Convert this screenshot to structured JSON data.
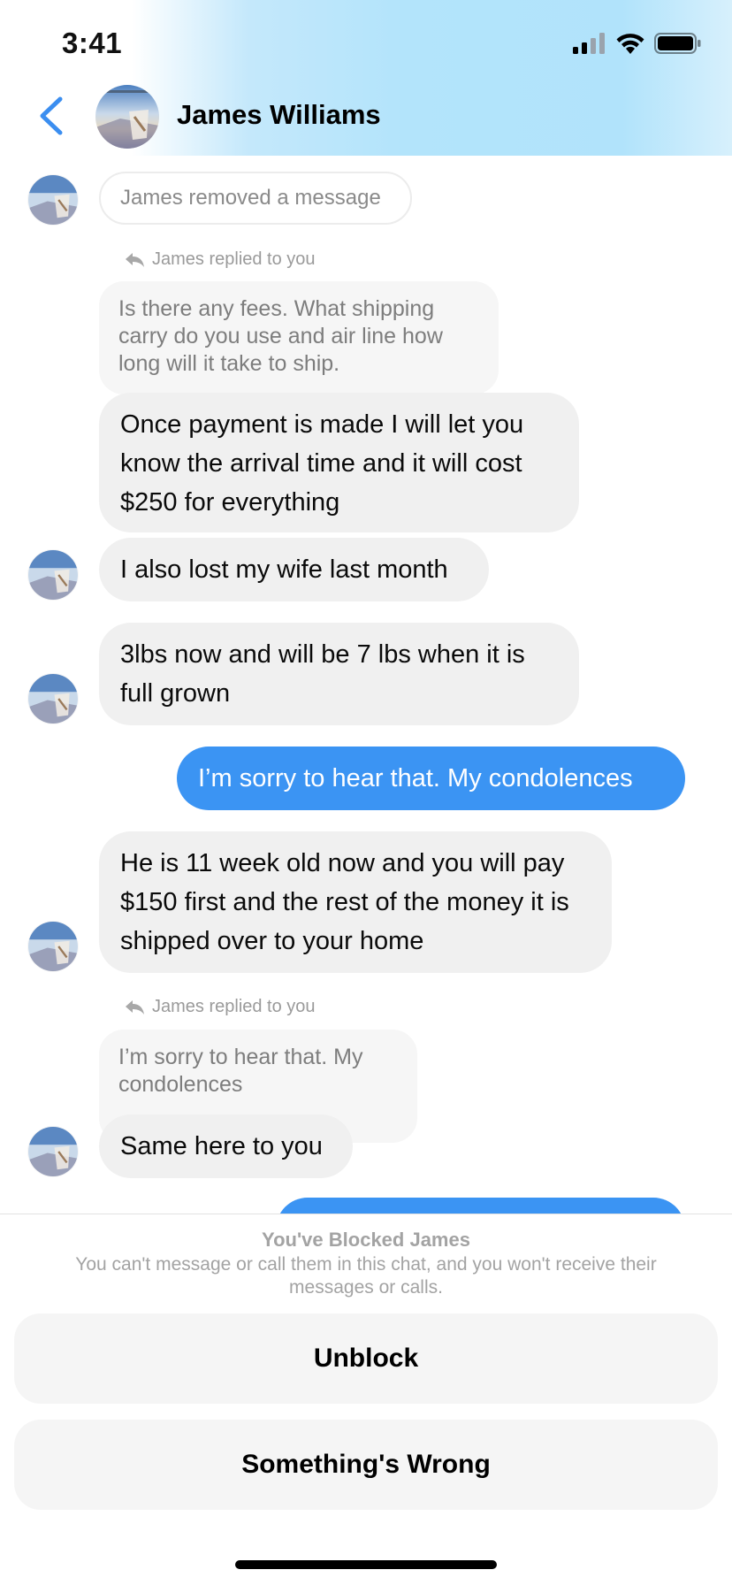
{
  "status_bar": {
    "time": "3:41"
  },
  "header": {
    "contact_name": "James Williams",
    "back_icon": "chevron-left-icon"
  },
  "messages": {
    "removed_notice": "James removed a message",
    "reply_1": {
      "label": "James replied to you",
      "quoted": "Is there any fees. What shipping carry do you use and air line how long will it take to ship.",
      "text": "Once payment is made I will let you know the arrival time and it will cost $250 for everything"
    },
    "msg_wife": "I also lost my wife last month",
    "msg_weight": "3lbs now and will be 7 lbs when it is full grown",
    "sent_condolences": "I’m sorry to hear that. My condolences",
    "msg_age": "He is 11 week old now and you will pay $150 first and the rest of the money it is shipped over to your home",
    "reply_2": {
      "label": "James replied to you",
      "quoted": "I’m sorry to hear that. My condolences",
      "text": "Same here to you"
    }
  },
  "blocked": {
    "title": "You've Blocked James",
    "description": "You can't message or call them in this chat, and you won't receive their messages or calls.",
    "unblock_label": "Unblock",
    "something_wrong_label": "Something's Wrong"
  },
  "colors": {
    "accent": "#3b94f3",
    "back_chevron": "#3b8ef0"
  }
}
